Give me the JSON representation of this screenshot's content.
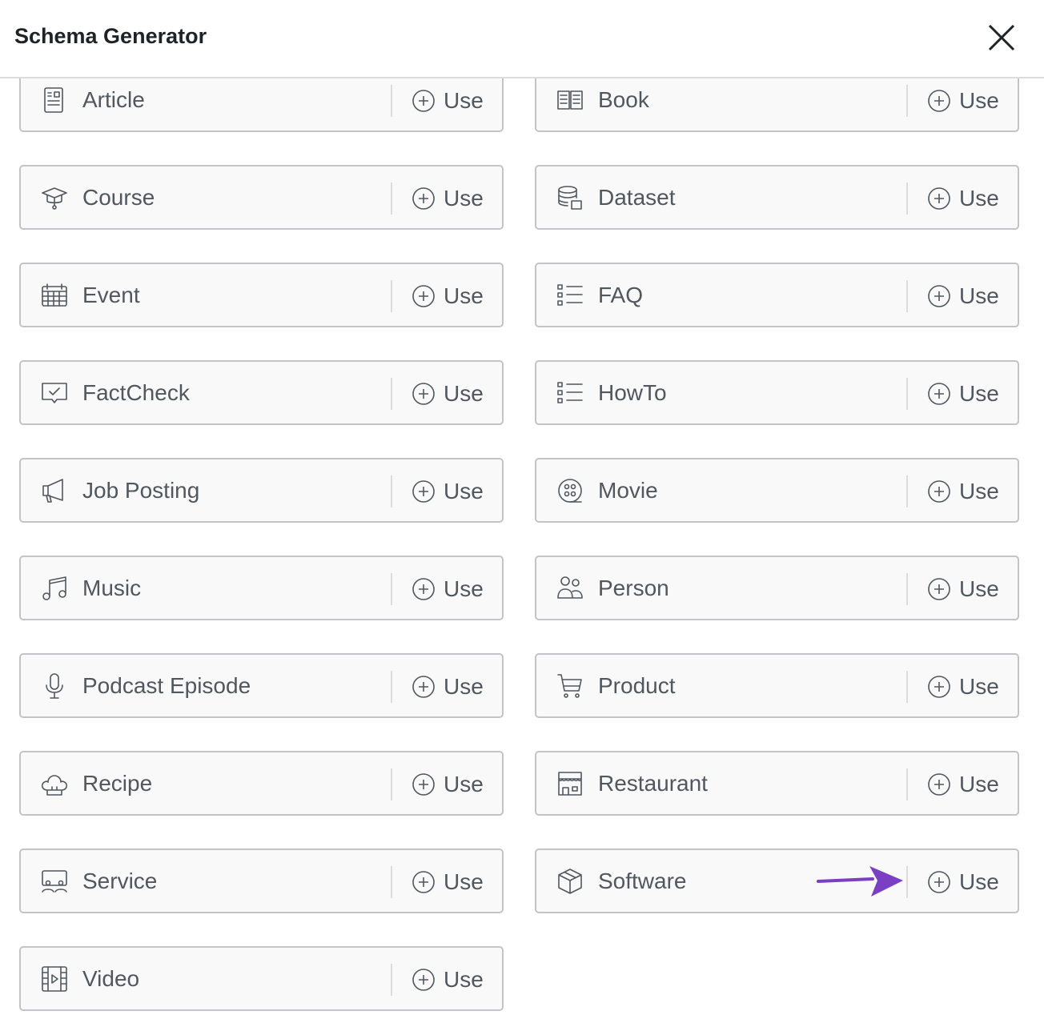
{
  "header": {
    "title": "Schema Generator",
    "close_icon": "close-icon"
  },
  "use_label": "Use",
  "annotation_color": "#7b3fc4",
  "schemas": [
    {
      "label": "Article",
      "icon": "article"
    },
    {
      "label": "Book",
      "icon": "book"
    },
    {
      "label": "Course",
      "icon": "course"
    },
    {
      "label": "Dataset",
      "icon": "dataset"
    },
    {
      "label": "Event",
      "icon": "event"
    },
    {
      "label": "FAQ",
      "icon": "list"
    },
    {
      "label": "FactCheck",
      "icon": "factcheck"
    },
    {
      "label": "HowTo",
      "icon": "list"
    },
    {
      "label": "Job Posting",
      "icon": "megaphone"
    },
    {
      "label": "Movie",
      "icon": "film-reel"
    },
    {
      "label": "Music",
      "icon": "music"
    },
    {
      "label": "Person",
      "icon": "person"
    },
    {
      "label": "Podcast Episode",
      "icon": "microphone"
    },
    {
      "label": "Product",
      "icon": "cart"
    },
    {
      "label": "Recipe",
      "icon": "chef-hat"
    },
    {
      "label": "Restaurant",
      "icon": "store"
    },
    {
      "label": "Service",
      "icon": "service"
    },
    {
      "label": "Software",
      "icon": "box"
    },
    {
      "label": "Video",
      "icon": "video"
    }
  ]
}
